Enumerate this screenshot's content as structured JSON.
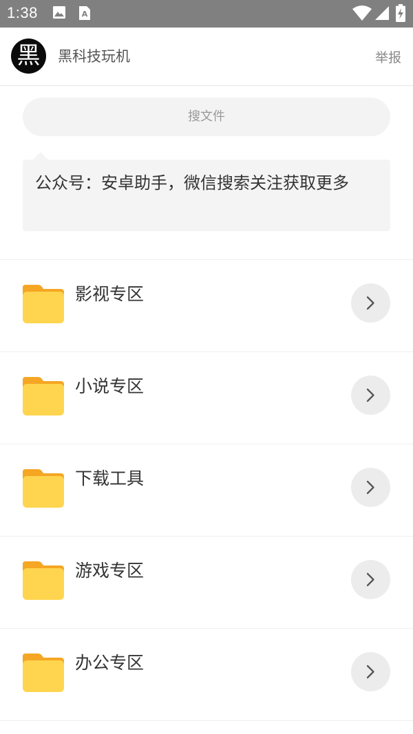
{
  "status_bar": {
    "time": "1:38",
    "icons": [
      "image-icon",
      "font-icon",
      "wifi-icon",
      "signal-icon",
      "battery-charging-icon"
    ]
  },
  "header": {
    "avatar_char": "黑",
    "title": "黑科技玩机",
    "report_label": "举报"
  },
  "search": {
    "placeholder": "搜文件"
  },
  "notice": {
    "text": "公众号：安卓助手，微信搜索关注获取更多"
  },
  "list": {
    "items": [
      {
        "label": "影视专区"
      },
      {
        "label": "小说专区"
      },
      {
        "label": "下载工具"
      },
      {
        "label": "游戏专区"
      },
      {
        "label": "办公专区"
      }
    ]
  },
  "colors": {
    "folder_front": "#FFD54F",
    "folder_back": "#F5A623",
    "status_bar_bg": "#808080",
    "chevron_bg": "#ECECEC"
  }
}
